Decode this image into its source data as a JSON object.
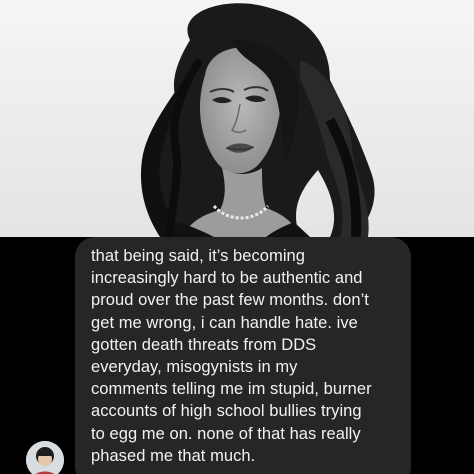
{
  "message": {
    "text": "that being said, it’s becoming\nincreasingly hard to be authentic and\nproud over the past few months. don’t\nget me wrong, i can handle hate. ive\ngotten death threats from DDS\neveryday, misogynists in my\ncomments telling me im stupid, burner\naccounts of high school bullies trying\nto egg me on. none of that has really\nphased me that much."
  },
  "colors": {
    "chat_background": "#000000",
    "bubble_background": "#262626",
    "message_text": "#f2f2f2",
    "photo_background": "#efefef"
  },
  "icons": {
    "avatar": "profile-avatar"
  }
}
